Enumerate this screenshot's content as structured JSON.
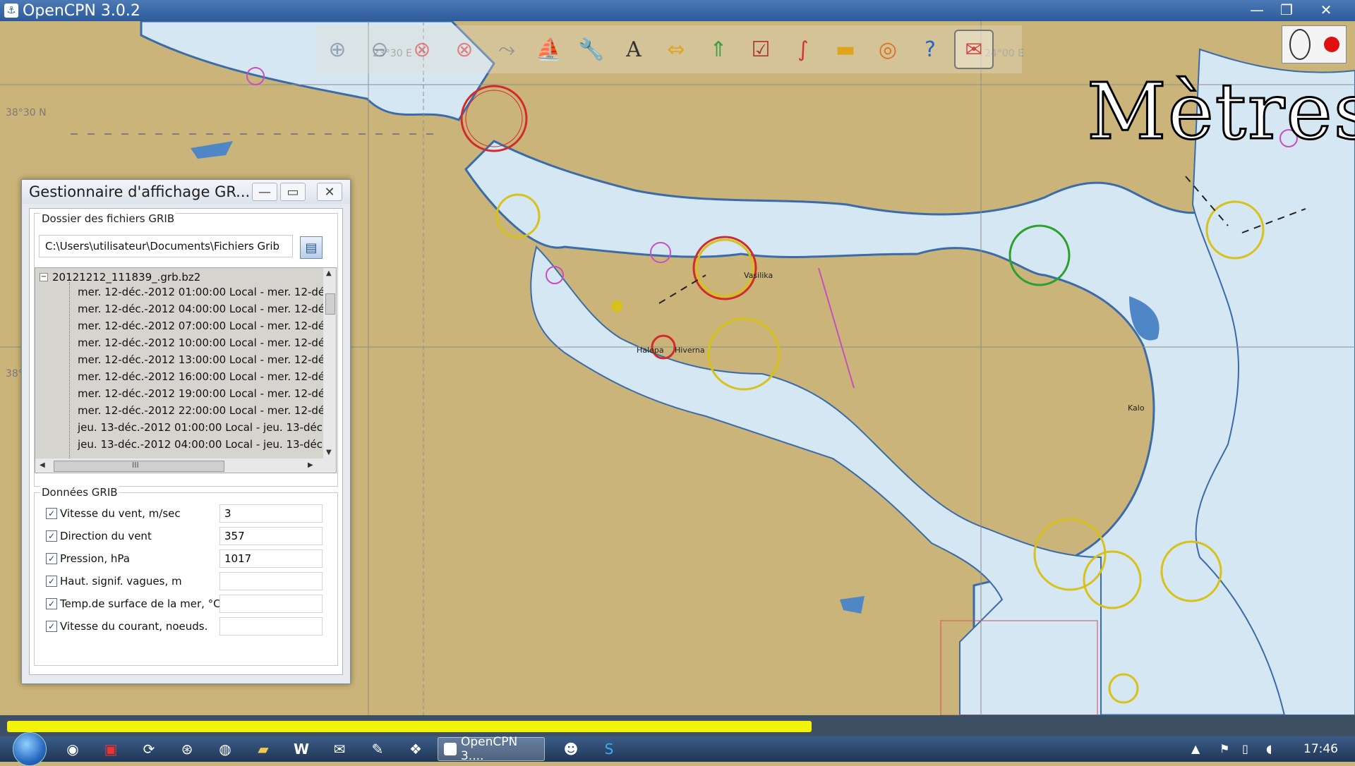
{
  "window": {
    "title": "OpenCPN 3.0.2",
    "minimize": "—",
    "maximize": "❐",
    "close": "✕"
  },
  "chart": {
    "scale_label": "Mètres",
    "lat_labels": [
      "38°30 N",
      "38°"
    ],
    "lon_labels": [
      "23°30 E",
      "24°00 E"
    ],
    "places": [
      "Halepa",
      "Hiverna",
      "Vasilika",
      "Kalo"
    ]
  },
  "toolbar": {
    "icons": [
      "zoom-in-icon",
      "zoom-out-icon",
      "route-cancel-icon",
      "cancel-icon",
      "route-icon",
      "ship-icon",
      "wrench-icon",
      "text-icon",
      "move-icon",
      "select-icon",
      "graph-icon",
      "track-icon",
      "layer-icon",
      "lifebuoy-icon",
      "help-icon",
      "grib-icon"
    ]
  },
  "dialog": {
    "title": "Gestionnaire d'affichage GR...",
    "folder_group": "Dossier des fichiers GRIB",
    "folder_path": "C:\\Users\\utilisateur\\Documents\\Fichiers Grib",
    "tree": {
      "root": "20121212_111839_.grb.bz2",
      "items": [
        "mer. 12-déc.-2012 01:00:00 Local - mer. 12-dé",
        "mer. 12-déc.-2012 04:00:00 Local - mer. 12-dé",
        "mer. 12-déc.-2012 07:00:00 Local - mer. 12-dé",
        "mer. 12-déc.-2012 10:00:00 Local - mer. 12-dé",
        "mer. 12-déc.-2012 13:00:00 Local - mer. 12-dé",
        "mer. 12-déc.-2012 16:00:00 Local - mer. 12-dé",
        "mer. 12-déc.-2012 19:00:00 Local - mer. 12-dé",
        "mer. 12-déc.-2012 22:00:00 Local - mer. 12-dé",
        "jeu. 13-déc.-2012 01:00:00 Local - jeu. 13-déc",
        "jeu. 13-déc.-2012 04:00:00 Local - jeu. 13-déc"
      ],
      "hscroll_mark": "III"
    },
    "data_group": "Données GRIB",
    "fields": [
      {
        "label": "Vitesse du vent, m/sec",
        "value": "3"
      },
      {
        "label": "Direction du vent",
        "value": "357"
      },
      {
        "label": "Pression, hPa",
        "value": "1017"
      },
      {
        "label": "Haut. signif. vagues, m",
        "value": ""
      },
      {
        "label": "Temp.de surface de la mer, °C",
        "value": ""
      },
      {
        "label": "Vitesse du courant, noeuds.",
        "value": ""
      }
    ]
  },
  "taskbar": {
    "active_task": "OpenCPN 3....",
    "clock": "17:46"
  }
}
